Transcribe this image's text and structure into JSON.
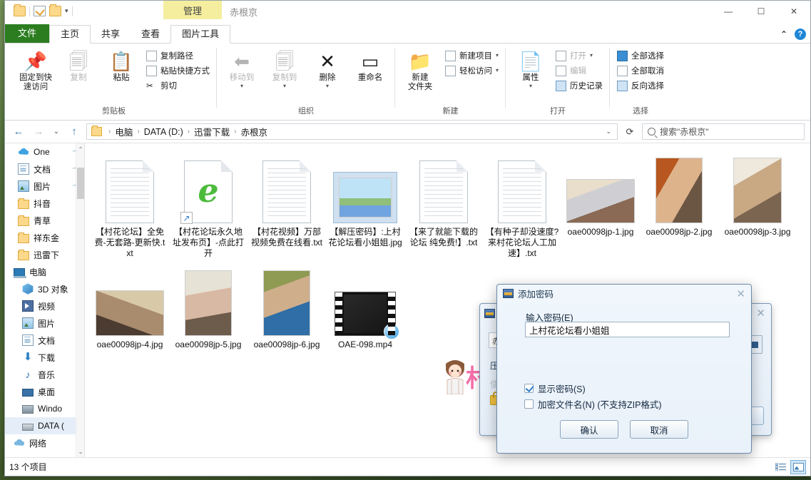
{
  "window": {
    "contextual_tab": "管理",
    "title": "赤根京",
    "minimize": "—",
    "maximize": "☐",
    "close": "✕",
    "collapse_ribbon": "⌃",
    "help": "?"
  },
  "quick_access": {
    "folder_icon": "folder-icon",
    "properties_icon": "properties-icon",
    "new_folder_icon": "new-folder-icon",
    "dropdown": "▾"
  },
  "tabs": [
    {
      "label": "文件",
      "type": "file"
    },
    {
      "label": "主页",
      "type": "active"
    },
    {
      "label": "共享",
      "type": "normal"
    },
    {
      "label": "查看",
      "type": "normal"
    },
    {
      "label": "图片工具",
      "type": "ctx"
    }
  ],
  "ribbon": {
    "groups": [
      {
        "title": "剪贴板",
        "big": [
          {
            "label_line1": "固定到快",
            "label_line2": "速访问",
            "icon": "pin-icon",
            "dim": false
          },
          {
            "label_line1": "复制",
            "label_line2": "",
            "icon": "copy-icon",
            "dim": true
          },
          {
            "label_line1": "粘贴",
            "label_line2": "",
            "icon": "paste-icon",
            "dim": false
          }
        ],
        "small": [
          {
            "label": "复制路径",
            "icon": "copy-path-icon",
            "dim": false
          },
          {
            "label": "粘贴快捷方式",
            "icon": "paste-shortcut-icon",
            "dim": false
          },
          {
            "label": "剪切",
            "icon": "scissors-icon",
            "dim": false
          }
        ]
      },
      {
        "title": "组织",
        "big": [
          {
            "label_line1": "移动到",
            "label_line2": "",
            "icon": "move-to-icon",
            "dim": true
          },
          {
            "label_line1": "复制到",
            "label_line2": "",
            "icon": "copy-to-icon",
            "dim": true
          },
          {
            "label_line1": "删除",
            "label_line2": "",
            "icon": "delete-icon",
            "dim": false
          },
          {
            "label_line1": "重命名",
            "label_line2": "",
            "icon": "rename-icon",
            "dim": false
          }
        ],
        "small": []
      },
      {
        "title": "新建",
        "big": [
          {
            "label_line1": "新建",
            "label_line2": "文件夹",
            "icon": "new-folder-icon",
            "dim": false
          }
        ],
        "small": [
          {
            "label": "新建项目",
            "icon": "new-item-icon",
            "dim": false,
            "caret": "▾"
          },
          {
            "label": "轻松访问",
            "icon": "easy-access-icon",
            "dim": false,
            "caret": "▾"
          }
        ]
      },
      {
        "title": "打开",
        "big": [
          {
            "label_line1": "属性",
            "label_line2": "",
            "icon": "properties-icon",
            "dim": false
          }
        ],
        "small": [
          {
            "label": "打开",
            "icon": "open-icon",
            "dim": true,
            "caret": "▾"
          },
          {
            "label": "编辑",
            "icon": "edit-icon",
            "dim": true
          },
          {
            "label": "历史记录",
            "icon": "history-icon",
            "dim": false
          }
        ]
      },
      {
        "title": "选择",
        "big": [],
        "small": [
          {
            "label": "全部选择",
            "icon": "select-all-icon",
            "dim": false
          },
          {
            "label": "全部取消",
            "icon": "select-none-icon",
            "dim": false
          },
          {
            "label": "反向选择",
            "icon": "invert-selection-icon",
            "dim": false
          }
        ]
      }
    ]
  },
  "address": {
    "back": "←",
    "forward": "→",
    "recent": "⌄",
    "up": "↑",
    "crumbs": [
      "电脑",
      "DATA (D:)",
      "迅雷下载",
      "赤根京"
    ],
    "separator": "›",
    "dropdown": "⌄",
    "refresh": "⟳",
    "search_placeholder": "搜索\"赤根京\""
  },
  "sidebar": {
    "items": [
      {
        "label": "One",
        "icon": "onedrive-icon",
        "pinned": true,
        "indent": 1,
        "selected": false
      },
      {
        "label": "文档",
        "icon": "documents-icon",
        "pinned": true,
        "indent": 1,
        "selected": false
      },
      {
        "label": "图片",
        "icon": "pictures-icon",
        "pinned": true,
        "indent": 1,
        "selected": false
      },
      {
        "label": "抖音",
        "icon": "folder-icon",
        "pinned": false,
        "indent": 1,
        "selected": false
      },
      {
        "label": "青草",
        "icon": "folder-icon",
        "pinned": false,
        "indent": 1,
        "selected": false
      },
      {
        "label": "祥东金",
        "icon": "folder-icon",
        "pinned": false,
        "indent": 1,
        "selected": false
      },
      {
        "label": "迅雷下",
        "icon": "folder-icon",
        "pinned": false,
        "indent": 1,
        "selected": false
      },
      {
        "label": "电脑",
        "icon": "computer-icon",
        "pinned": false,
        "indent": 0,
        "selected": false
      },
      {
        "label": "3D 对象",
        "icon": "3d-objects-icon",
        "pinned": false,
        "indent": 1,
        "selected": false
      },
      {
        "label": "视频",
        "icon": "videos-icon",
        "pinned": false,
        "indent": 1,
        "selected": false
      },
      {
        "label": "图片",
        "icon": "pictures-icon",
        "pinned": false,
        "indent": 1,
        "selected": false
      },
      {
        "label": "文档",
        "icon": "documents-icon",
        "pinned": false,
        "indent": 1,
        "selected": false
      },
      {
        "label": "下载",
        "icon": "downloads-icon",
        "pinned": false,
        "indent": 1,
        "selected": false
      },
      {
        "label": "音乐",
        "icon": "music-icon",
        "pinned": false,
        "indent": 1,
        "selected": false
      },
      {
        "label": "桌面",
        "icon": "desktop-icon",
        "pinned": false,
        "indent": 1,
        "selected": false
      },
      {
        "label": "Windo",
        "icon": "windows-drive-icon",
        "pinned": false,
        "indent": 1,
        "selected": false
      },
      {
        "label": "DATA (",
        "icon": "drive-icon",
        "pinned": false,
        "indent": 1,
        "selected": true
      },
      {
        "label": "网络",
        "icon": "network-icon",
        "pinned": false,
        "indent": 0,
        "selected": false
      }
    ]
  },
  "files": [
    {
      "name": "【村花论坛】全免费-无套路-更新快.txt",
      "kind": "txt"
    },
    {
      "name": "【村花论坛永久地址发布页】-点此打开",
      "kind": "ie-shortcut"
    },
    {
      "name": "【村花视频】万部视频免费在线看.txt",
      "kind": "txt"
    },
    {
      "name": "【解压密码】:上村花论坛看小姐姐.jpg",
      "kind": "photo-frame"
    },
    {
      "name": "【来了就能下载的论坛 纯免费!】.txt",
      "kind": "txt"
    },
    {
      "name": "【有种子却没速度? 来村花论坛人工加速】.txt",
      "kind": "txt"
    },
    {
      "name": "oae00098jp-1.jpg",
      "kind": "photo",
      "tone": "p1"
    },
    {
      "name": "oae00098jp-2.jpg",
      "kind": "photo",
      "tone": "p2"
    },
    {
      "name": "oae00098jp-3.jpg",
      "kind": "photo",
      "tone": "p3"
    },
    {
      "name": "oae00098jp-4.jpg",
      "kind": "photo",
      "tone": "p4"
    },
    {
      "name": "oae00098jp-5.jpg",
      "kind": "photo",
      "tone": "p5"
    },
    {
      "name": "oae00098jp-6.jpg",
      "kind": "photo",
      "tone": "p6"
    },
    {
      "name": "OAE-098.mp4",
      "kind": "video"
    }
  ],
  "watermark": {
    "text": "村花论坛"
  },
  "status": {
    "items_text": "13 个项目",
    "view_details": "details-view-icon",
    "view_large": "large-icons-view-icon"
  },
  "dialog_back": {
    "title": "",
    "field_value": "赤",
    "label1": "压",
    "label2": "使",
    "close": "✕"
  },
  "dialog_front": {
    "title": "添加密码",
    "close": "✕",
    "password_label": "输入密码(E)",
    "password_value": "上村花论坛看小姐姐",
    "show_password_label": "显示密码(S)",
    "show_password_checked": true,
    "encrypt_names_label": "加密文件名(N) (不支持ZIP格式)",
    "encrypt_names_checked": false,
    "ok": "确认",
    "cancel": "取消"
  }
}
